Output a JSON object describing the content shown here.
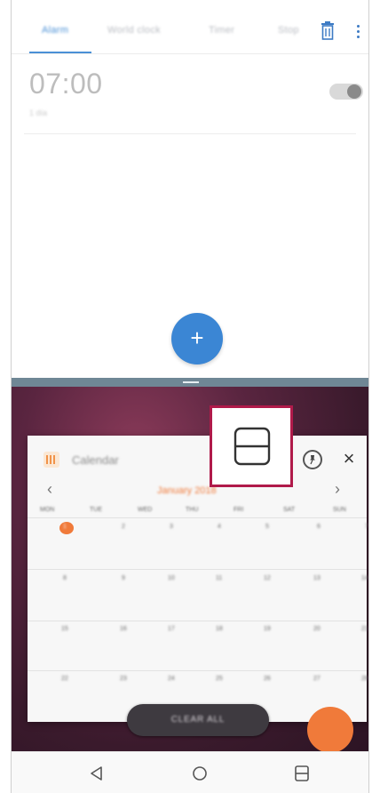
{
  "clock": {
    "tabs": [
      "Alarm",
      "World clock",
      "Timer",
      "Stop"
    ],
    "alarm_time": "07:00",
    "alarm_sub": "1 día",
    "fab_label": "+"
  },
  "recents": {
    "card": {
      "app_name": "Calendar",
      "month": "January 2018",
      "prev": "‹",
      "next": "›",
      "weekdays": [
        "MON",
        "TUE",
        "WED",
        "THU",
        "FRI",
        "SAT",
        "SUN"
      ],
      "weeks": [
        [
          "1",
          "2",
          "3",
          "4",
          "5",
          "6",
          "7"
        ],
        [
          "8",
          "9",
          "10",
          "11",
          "12",
          "13",
          "14"
        ],
        [
          "15",
          "16",
          "17",
          "18",
          "19",
          "20",
          "21"
        ],
        [
          "22",
          "23",
          "24",
          "25",
          "26",
          "27",
          "28"
        ]
      ],
      "close": "×"
    },
    "clear_all_label": "CLEAR ALL"
  },
  "icons": {
    "delete": "trash-icon",
    "more": "more-vertical-icon",
    "pin": "pin-icon",
    "split_view": "split-screen-icon",
    "back": "back-icon",
    "home": "home-icon",
    "recents": "recents-icon"
  },
  "colors": {
    "accent": "#3b86d4",
    "highlight": "#b01a4a",
    "calendar_accent": "#f07a3a"
  }
}
